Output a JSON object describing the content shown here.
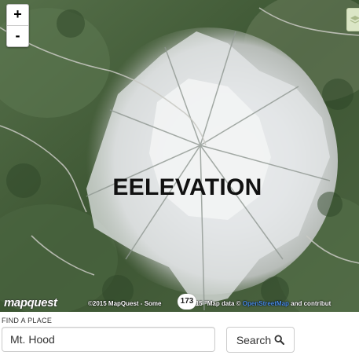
{
  "map": {
    "zoom_in_label": "+",
    "zoom_out_label": "-",
    "title": "EELEVATION",
    "logo_text": "mapquest",
    "copyright_prefix": "©2015 MapQuest - Some",
    "copyright_mid": "2015 \"Map data ©",
    "copyright_link": "OpenStreetMap",
    "copyright_suffix": "and contribut",
    "marker_badge": "173"
  },
  "search": {
    "label": "FIND A PLACE",
    "value": "Mt. Hood",
    "button_label": "Search",
    "button_icon": "search-icon"
  },
  "colors": {
    "snow": "#eef0ee",
    "forest": "#3f5a34",
    "link": "#4a8ee8"
  }
}
